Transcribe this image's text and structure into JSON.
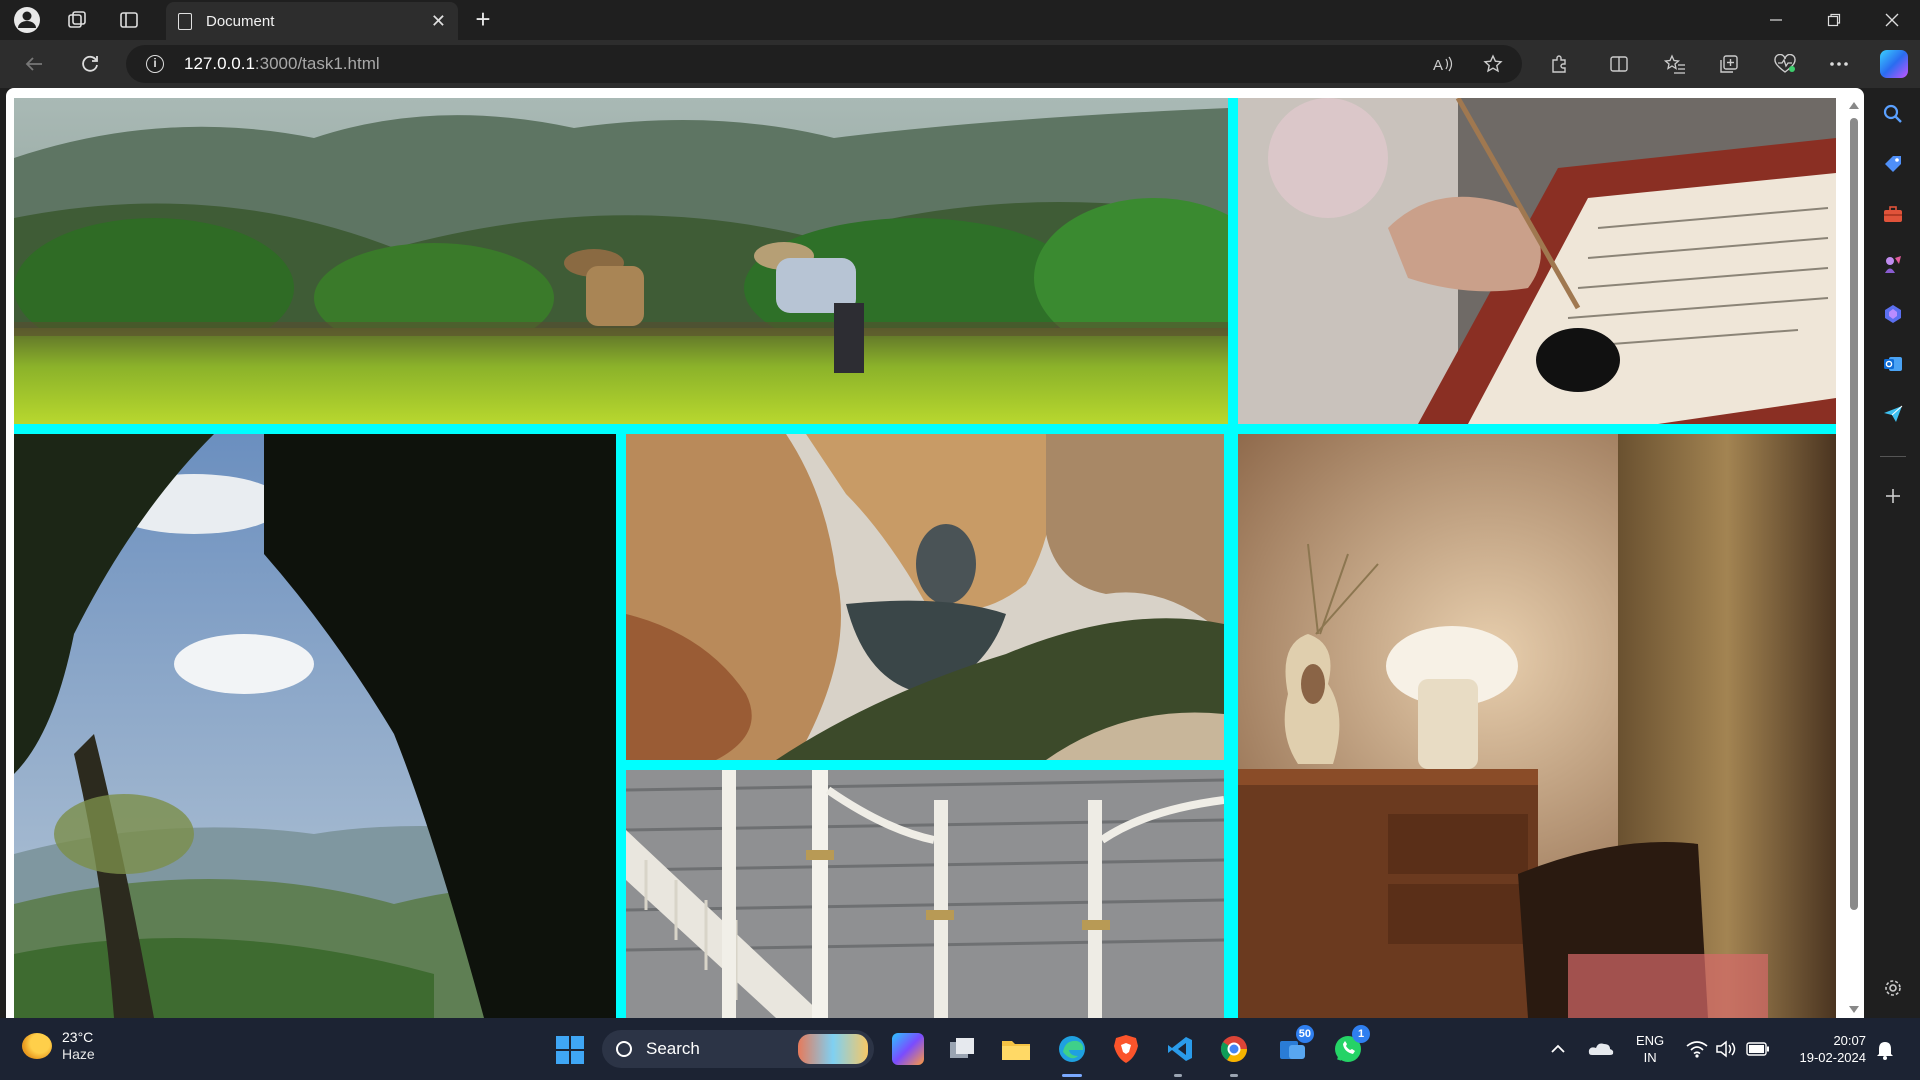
{
  "browser": {
    "tab_title": "Document",
    "url_host": "127.0.0.1",
    "url_path": ":3000/task1.html",
    "new_tab_label": "+",
    "close_tab_label": "✕"
  },
  "gallery": {
    "border_color": "#00ffff",
    "images": [
      {
        "name": "rice-farmers-photo",
        "subject": "Farmers planting rice in a green field with mountains"
      },
      {
        "name": "calligraphy-photo",
        "subject": "Hand writing with a dip pen next to an ink bottle"
      },
      {
        "name": "forest-valley-photo",
        "subject": "Tree branches framing a hazy green valley"
      },
      {
        "name": "sea-cliffs-photo",
        "subject": "Orange rock cliffs with a sea arch"
      },
      {
        "name": "warm-lamp-room-photo",
        "subject": "Mushroom lamp on a wooden cabinet beside a vase"
      },
      {
        "name": "iron-roof-photo",
        "subject": "White iron columns under a pitched roof"
      }
    ]
  },
  "taskbar": {
    "weather_temp": "23°C",
    "weather_condition": "Haze",
    "search_label": "Search",
    "lang_top": "ENG",
    "lang_bottom": "IN",
    "time": "20:07",
    "date": "19-02-2024",
    "teams_badge": "50",
    "whatsapp_badge": "1"
  }
}
